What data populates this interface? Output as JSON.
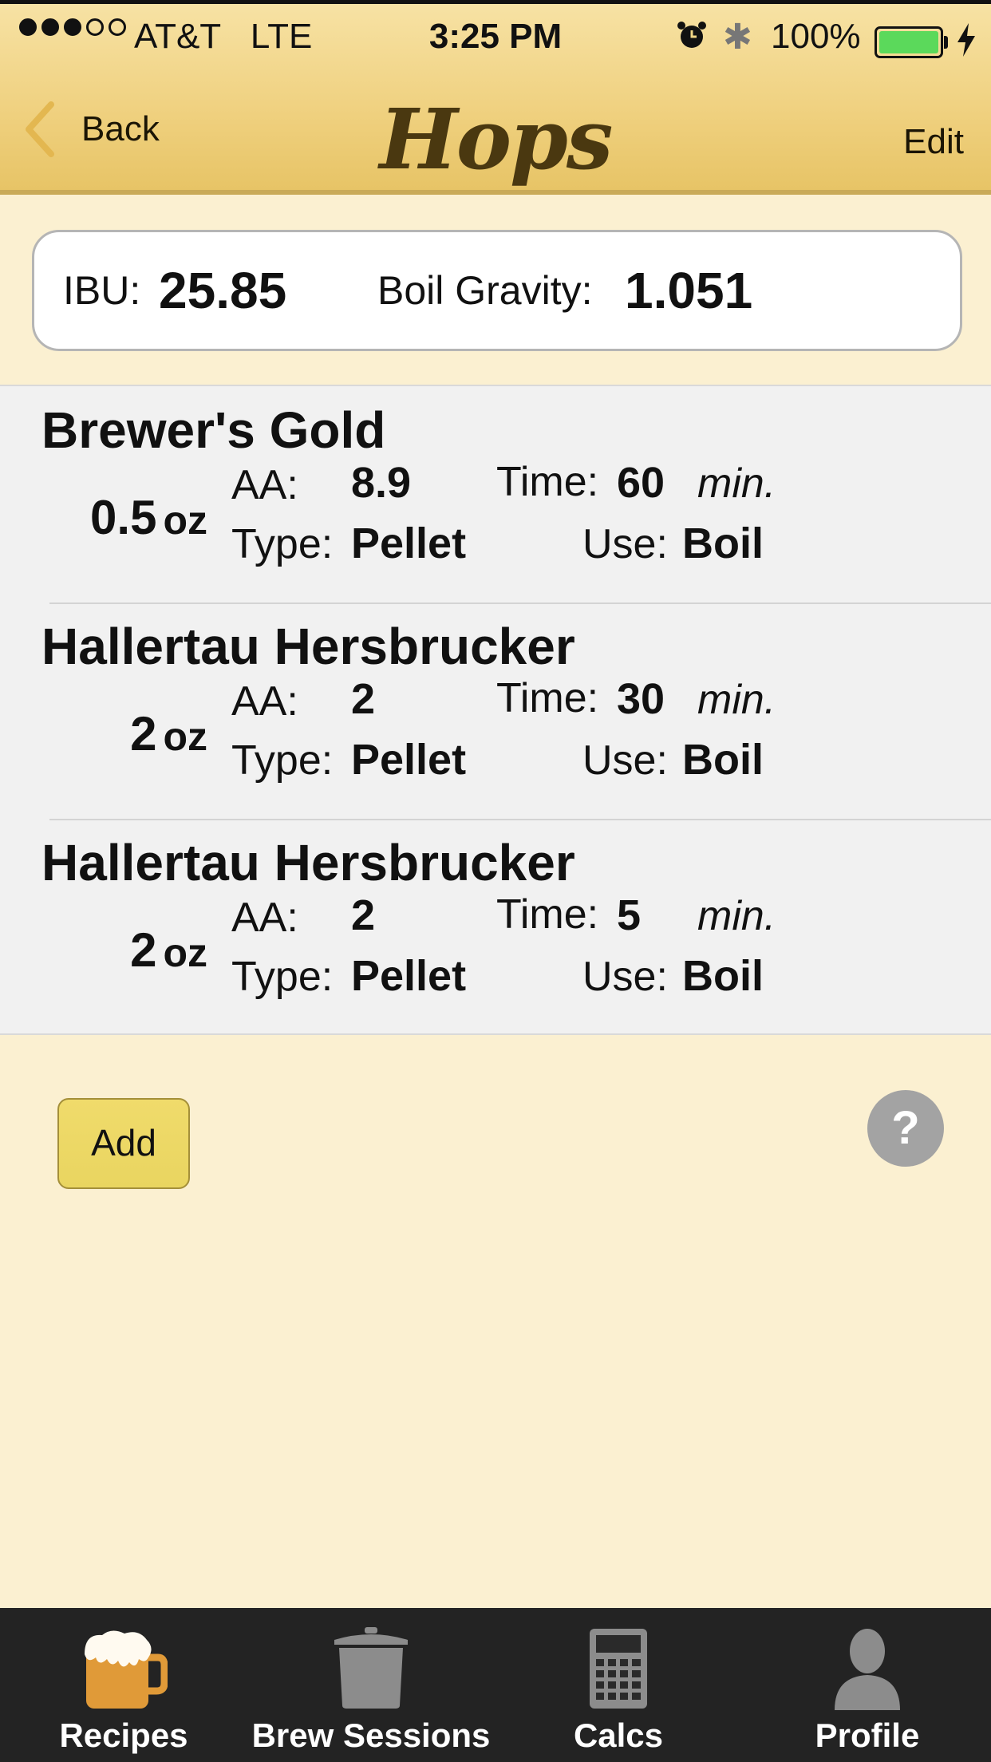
{
  "status_bar": {
    "carrier": "AT&T",
    "network": "LTE",
    "time": "3:25 PM",
    "battery_percent": "100%",
    "signal_strength": 3
  },
  "nav": {
    "back_label": "Back",
    "title": "Hops",
    "edit_label": "Edit"
  },
  "summary": {
    "ibu_label": "IBU:",
    "ibu_value": "25.85",
    "gravity_label": "Boil Gravity:",
    "gravity_value": "1.051"
  },
  "labels": {
    "aa": "AA:",
    "time": "Time:",
    "min": "min.",
    "type": "Type:",
    "use": "Use:"
  },
  "hops": [
    {
      "name": "Brewer's Gold",
      "amount": "0.5",
      "unit": "oz",
      "aa": "8.9",
      "time": "60",
      "type": "Pellet",
      "use": "Boil"
    },
    {
      "name": "Hallertau Hersbrucker",
      "amount": "2",
      "unit": "oz",
      "aa": "2",
      "time": "30",
      "type": "Pellet",
      "use": "Boil"
    },
    {
      "name": "Hallertau Hersbrucker",
      "amount": "2",
      "unit": "oz",
      "aa": "2",
      "time": "5",
      "type": "Pellet",
      "use": "Boil"
    }
  ],
  "actions": {
    "add_label": "Add",
    "help_label": "?"
  },
  "tabs": [
    {
      "label": "Recipes",
      "icon": "beer-mug-icon",
      "active": true
    },
    {
      "label": "Brew Sessions",
      "icon": "brew-pot-icon",
      "active": false
    },
    {
      "label": "Calcs",
      "icon": "calculator-icon",
      "active": false
    },
    {
      "label": "Profile",
      "icon": "profile-icon",
      "active": false
    }
  ],
  "colors": {
    "background": "#fbf0d1",
    "header": "#efd07e",
    "title": "#4a3810",
    "add_button": "#ecd865",
    "tab_bar": "#232323",
    "active_tab_icon": "#e09a38",
    "inactive_tab_icon": "#8c8c8c"
  }
}
